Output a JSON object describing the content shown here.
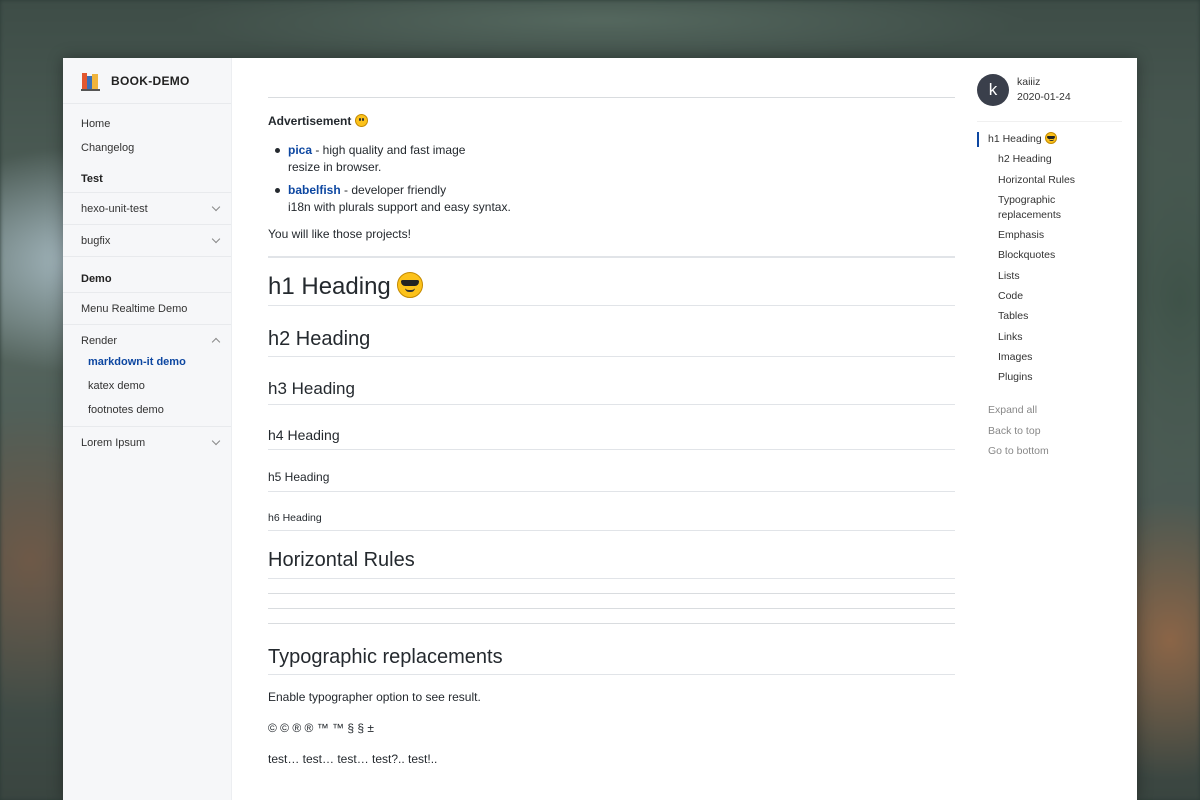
{
  "brand": {
    "name": "BOOK-DEMO"
  },
  "sidebar": {
    "top_items": [
      "Home",
      "Changelog"
    ],
    "section_test": "Test",
    "groups_test": [
      "hexo-unit-test",
      "bugfix"
    ],
    "section_demo": "Demo",
    "menu_realtime": "Menu Realtime Demo",
    "render_group": "Render",
    "render_items": [
      "markdown-it demo",
      "katex demo",
      "footnotes demo"
    ],
    "lorem": "Lorem Ipsum"
  },
  "main": {
    "ad_title": "Advertisement",
    "projects": [
      {
        "name": "pica",
        "desc_1": " - high quality and fast image",
        "desc_2": "resize in browser."
      },
      {
        "name": "babelfish",
        "desc_1": " - developer friendly",
        "desc_2": "i18n with plurals support and easy syntax."
      }
    ],
    "like": "You will like those projects!",
    "h1": "h1 Heading",
    "h2": "h2 Heading",
    "h3": "h3 Heading",
    "h4": "h4 Heading",
    "h5": "h5 Heading",
    "h6": "h6 Heading",
    "hr_heading": "Horizontal Rules",
    "typo_heading": "Typographic replacements",
    "typo_note": "Enable typographer option to see result.",
    "typo_symbols": "© © ® ® ™ ™ § § ±",
    "typo_test": "test… test… test… test?.. test!.."
  },
  "author": {
    "initial": "k",
    "name": "kaiiiz",
    "date": "2020-01-24"
  },
  "toc": {
    "items": [
      {
        "label": "h1 Heading",
        "level": 1
      },
      {
        "label": "h2 Heading",
        "level": 2
      },
      {
        "label": "Horizontal Rules",
        "level": 2
      },
      {
        "label": "Typographic replacements",
        "level": 2
      },
      {
        "label": "Emphasis",
        "level": 2
      },
      {
        "label": "Blockquotes",
        "level": 2
      },
      {
        "label": "Lists",
        "level": 2
      },
      {
        "label": "Code",
        "level": 2
      },
      {
        "label": "Tables",
        "level": 2
      },
      {
        "label": "Links",
        "level": 2
      },
      {
        "label": "Images",
        "level": 2
      },
      {
        "label": "Plugins",
        "level": 2
      }
    ],
    "actions": [
      "Expand all",
      "Back to top",
      "Go to bottom"
    ]
  },
  "icons": {
    "smile": "smiling-face-icon",
    "cool": "sunglasses-face-icon",
    "logo": "books-icon"
  },
  "colors": {
    "link": "#0d47a1",
    "sidebar_bg": "#f6f7f9",
    "avatar_bg": "#3a3f4b"
  }
}
